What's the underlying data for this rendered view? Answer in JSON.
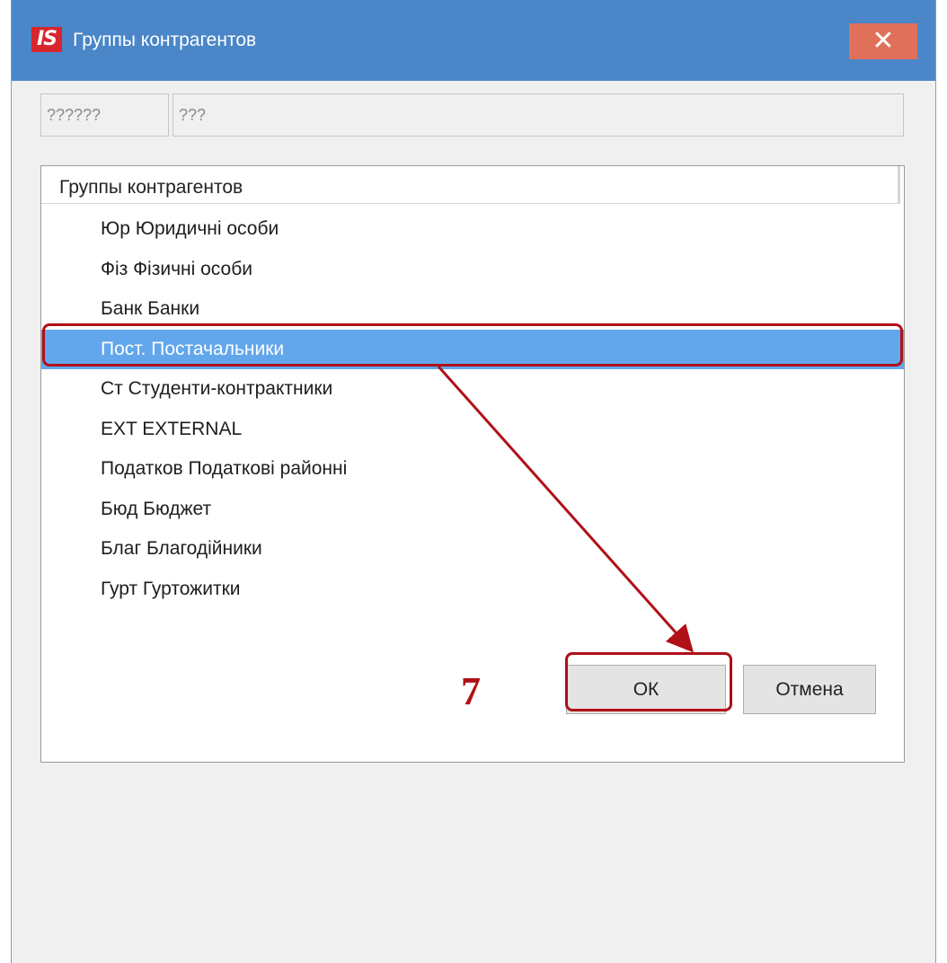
{
  "window": {
    "title": "Группы контрагентов",
    "logo_text": "IS",
    "close_icon": "close-icon",
    "close_glyph": "✕"
  },
  "fields": {
    "code_value": "??????",
    "name_value": "???"
  },
  "tree": {
    "header": "Группы контрагентов",
    "items": [
      {
        "label": "Юр Юридичні особи"
      },
      {
        "label": "Фіз Фізичні особи"
      },
      {
        "label": "Банк Банки"
      },
      {
        "label": "Пост. Постачальники",
        "selected": true
      },
      {
        "label": "Ст Студенти-контрактники"
      },
      {
        "label": "EXT EXTERNAL"
      },
      {
        "label": "Податков Податкові районні"
      },
      {
        "label": "Бюд Бюджет"
      },
      {
        "label": "Благ Благодійники"
      },
      {
        "label": "Гурт Гуртожитки"
      }
    ]
  },
  "buttons": {
    "ok_label": "ОК",
    "cancel_label": "Отмена"
  },
  "annotation": {
    "step_number": "7",
    "color": "#b01018"
  },
  "colors": {
    "titlebar": "#4a86c8",
    "selection": "#62a6ec",
    "close_button": "#e0705a",
    "logo": "#d7252e"
  }
}
